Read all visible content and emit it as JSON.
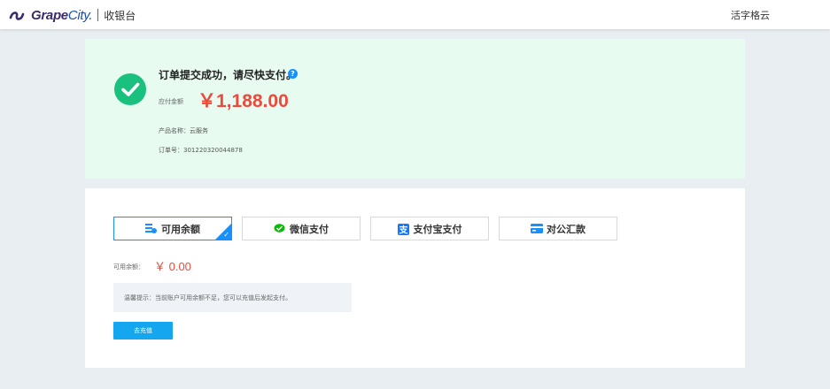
{
  "header": {
    "brand_part1": "Grape",
    "brand_part2": "City.",
    "cashier_label": "收银台",
    "user_name": "活字格云"
  },
  "success": {
    "title": "订单提交成功，请尽快支付。",
    "help_icon": "?",
    "amount_label": "应付金额",
    "amount": "￥1,188.00",
    "product_label": "产品名称：",
    "product_value": "云服务",
    "order_label": "订单号：",
    "order_value": "301220320044878"
  },
  "payment": {
    "methods": [
      {
        "label": "可用余额",
        "icon": "balance-icon",
        "active": true
      },
      {
        "label": "微信支付",
        "icon": "wechat-icon",
        "active": false
      },
      {
        "label": "支付宝支付",
        "icon": "alipay-icon",
        "active": false
      },
      {
        "label": "对公汇款",
        "icon": "bank-card-icon",
        "active": false
      }
    ],
    "balance_label": "可用余额：",
    "balance_value": "￥ 0.00",
    "tip": "温馨提示：当前账户可用余额不足，您可以充值后发起支付。",
    "recharge_label": "去充值"
  },
  "colors": {
    "accent": "#1890ff",
    "success": "#19c07e",
    "amount": "#ec4a3a",
    "button": "#14a7f0"
  }
}
